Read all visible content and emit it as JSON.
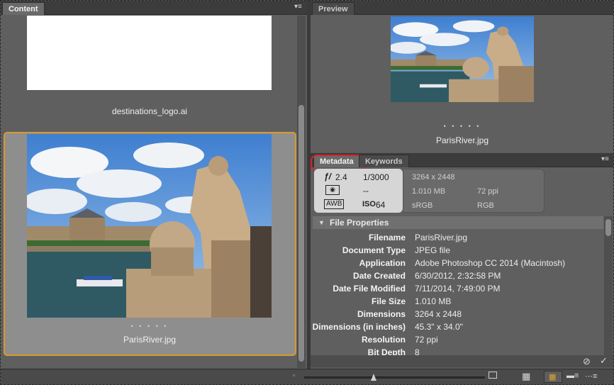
{
  "content_panel": {
    "tab_label": "Content",
    "items": [
      {
        "name": "destinations_logo.ai"
      },
      {
        "name": "ParisRiver.jpg",
        "selected": true
      }
    ]
  },
  "preview_panel": {
    "tab_label": "Preview",
    "filename": "ParisRiver.jpg"
  },
  "metadata_panel": {
    "tabs": [
      {
        "label": "Metadata",
        "active": true
      },
      {
        "label": "Keywords",
        "active": false
      }
    ],
    "placard": {
      "aperture": "2.4",
      "shutter": "1/3000",
      "metering": "--",
      "iso": "64",
      "awb_label": "AWB",
      "iso_label": "ISO"
    },
    "placard_info": {
      "dimensions": "3264 x 2448",
      "file_size": "1.010 MB",
      "resolution": "72 ppi",
      "color_profile": "sRGB",
      "color_mode": "RGB"
    },
    "section_title": "File Properties",
    "rows": [
      {
        "label": "Filename",
        "value": "ParisRiver.jpg"
      },
      {
        "label": "Document Type",
        "value": "JPEG file"
      },
      {
        "label": "Application",
        "value": "Adobe Photoshop CC 2014 (Macintosh)"
      },
      {
        "label": "Date Created",
        "value": "6/30/2012, 2:32:58 PM"
      },
      {
        "label": "Date File Modified",
        "value": "7/11/2014, 7:49:00 PM"
      },
      {
        "label": "File Size",
        "value": "1.010 MB"
      },
      {
        "label": "Dimensions",
        "value": "3264 x 2448"
      },
      {
        "label": "Dimensions (in inches)",
        "value": "45.3\" x 34.0\""
      },
      {
        "label": "Resolution",
        "value": "72 ppi"
      },
      {
        "label": "Bit Depth",
        "value": "8"
      }
    ]
  },
  "colors": {
    "selection_border": "#d89a2c",
    "highlight_ring": "#d8242c"
  }
}
